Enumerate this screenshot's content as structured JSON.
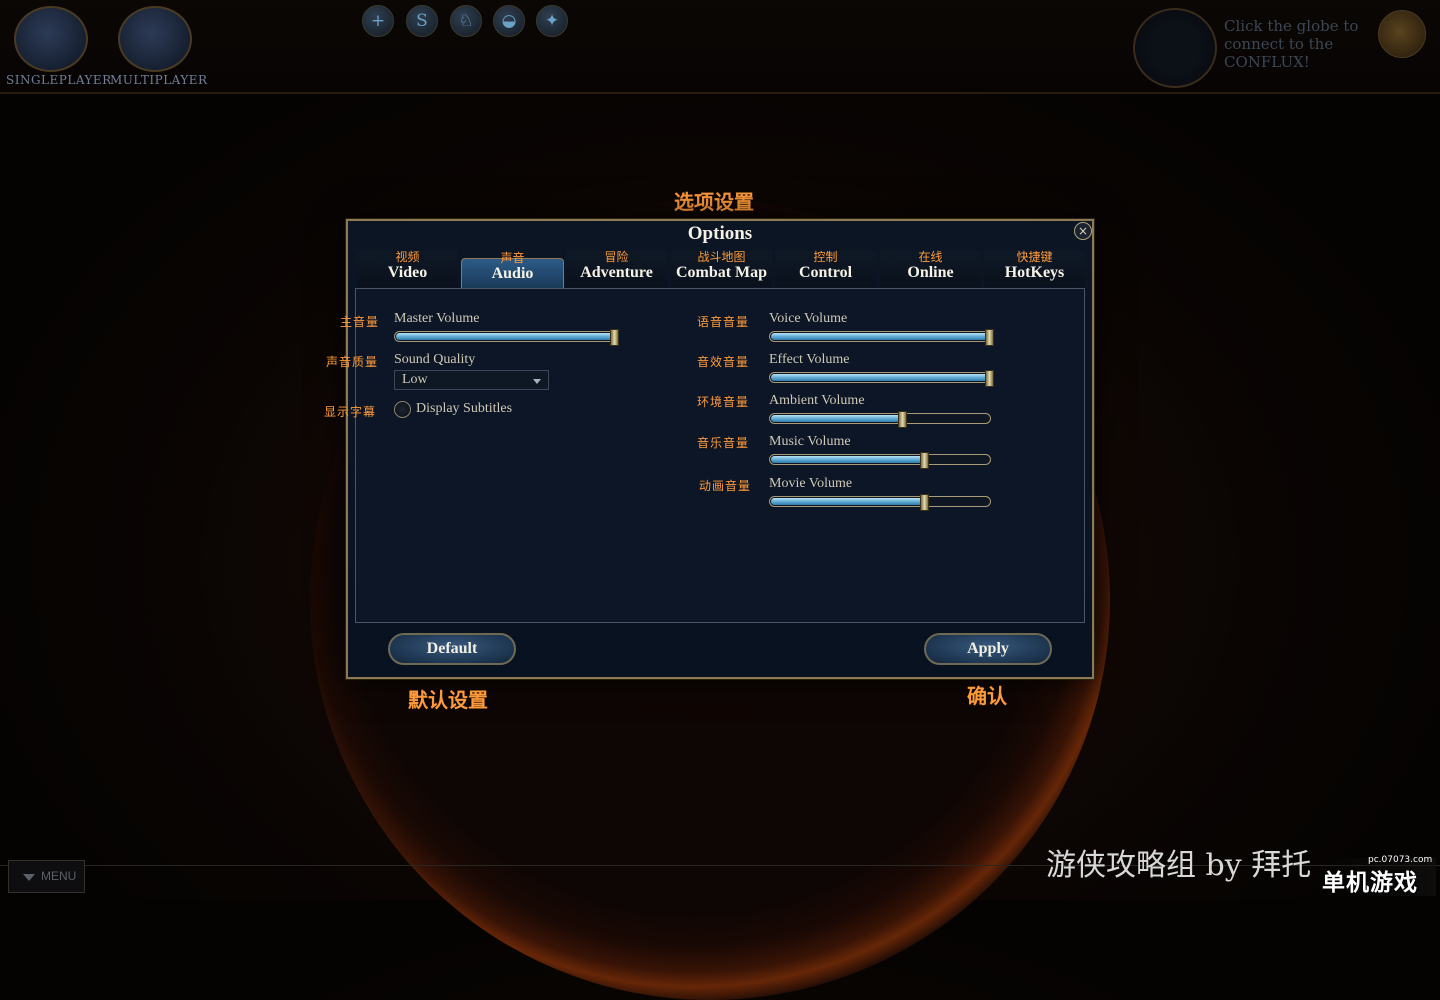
{
  "top_bar": {
    "modes": [
      {
        "label": "SINGLEPLAYER"
      },
      {
        "label": "MULTIPLAYER"
      }
    ],
    "icons": [
      {
        "name": "plus-icon",
        "glyph": "+"
      },
      {
        "name": "s-icon",
        "glyph": "S"
      },
      {
        "name": "armor-icon",
        "glyph": "♘"
      },
      {
        "name": "helmet-icon",
        "glyph": "◒"
      },
      {
        "name": "skill-icon",
        "glyph": "✦"
      }
    ],
    "globe_hint": "Click the globe to connect to the CONFLUX!"
  },
  "annotations": {
    "options_title_cn": "选项设置",
    "default_cn": "默认设置",
    "apply_cn": "确认"
  },
  "dialog": {
    "title": "Options",
    "close_glyph": "×",
    "tabs": [
      {
        "cn": "视频",
        "en": "Video",
        "active": false
      },
      {
        "cn": "声音",
        "en": "Audio",
        "active": true
      },
      {
        "cn": "冒险",
        "en": "Adventure",
        "active": false
      },
      {
        "cn": "战斗地图",
        "en": "Combat Map",
        "active": false
      },
      {
        "cn": "控制",
        "en": "Control",
        "active": false
      },
      {
        "cn": "在线",
        "en": "Online",
        "active": false
      },
      {
        "cn": "快捷键",
        "en": "HotKeys",
        "active": false
      }
    ],
    "left": {
      "master_volume": {
        "cn": "主音量",
        "label": "Master Volume",
        "level": 1.0
      },
      "sound_quality": {
        "cn": "声音质量",
        "label": "Sound Quality",
        "value": "Low"
      },
      "subtitles": {
        "cn": "显示字幕",
        "label": "Display Subtitles",
        "checked": false
      }
    },
    "right": {
      "voice_volume": {
        "cn": "语音音量",
        "label": "Voice Volume",
        "level": 1.0
      },
      "effect_volume": {
        "cn": "音效音量",
        "label": "Effect Volume",
        "level": 1.0
      },
      "ambient_volume": {
        "cn": "环境音量",
        "label": "Ambient Volume",
        "level": 0.6
      },
      "music_volume": {
        "cn": "音乐音量",
        "label": "Music Volume",
        "level": 0.7
      },
      "movie_volume": {
        "cn": "动画音量",
        "label": "Movie Volume",
        "level": 0.7
      }
    },
    "buttons": {
      "default_label": "Default",
      "apply_label": "Apply"
    }
  },
  "bottom": {
    "menu_label": "MENU",
    "watermark": "游侠攻略组 by 拜托",
    "site_logo": {
      "main": "单机游戏",
      "url": "pc.07073.com"
    }
  }
}
